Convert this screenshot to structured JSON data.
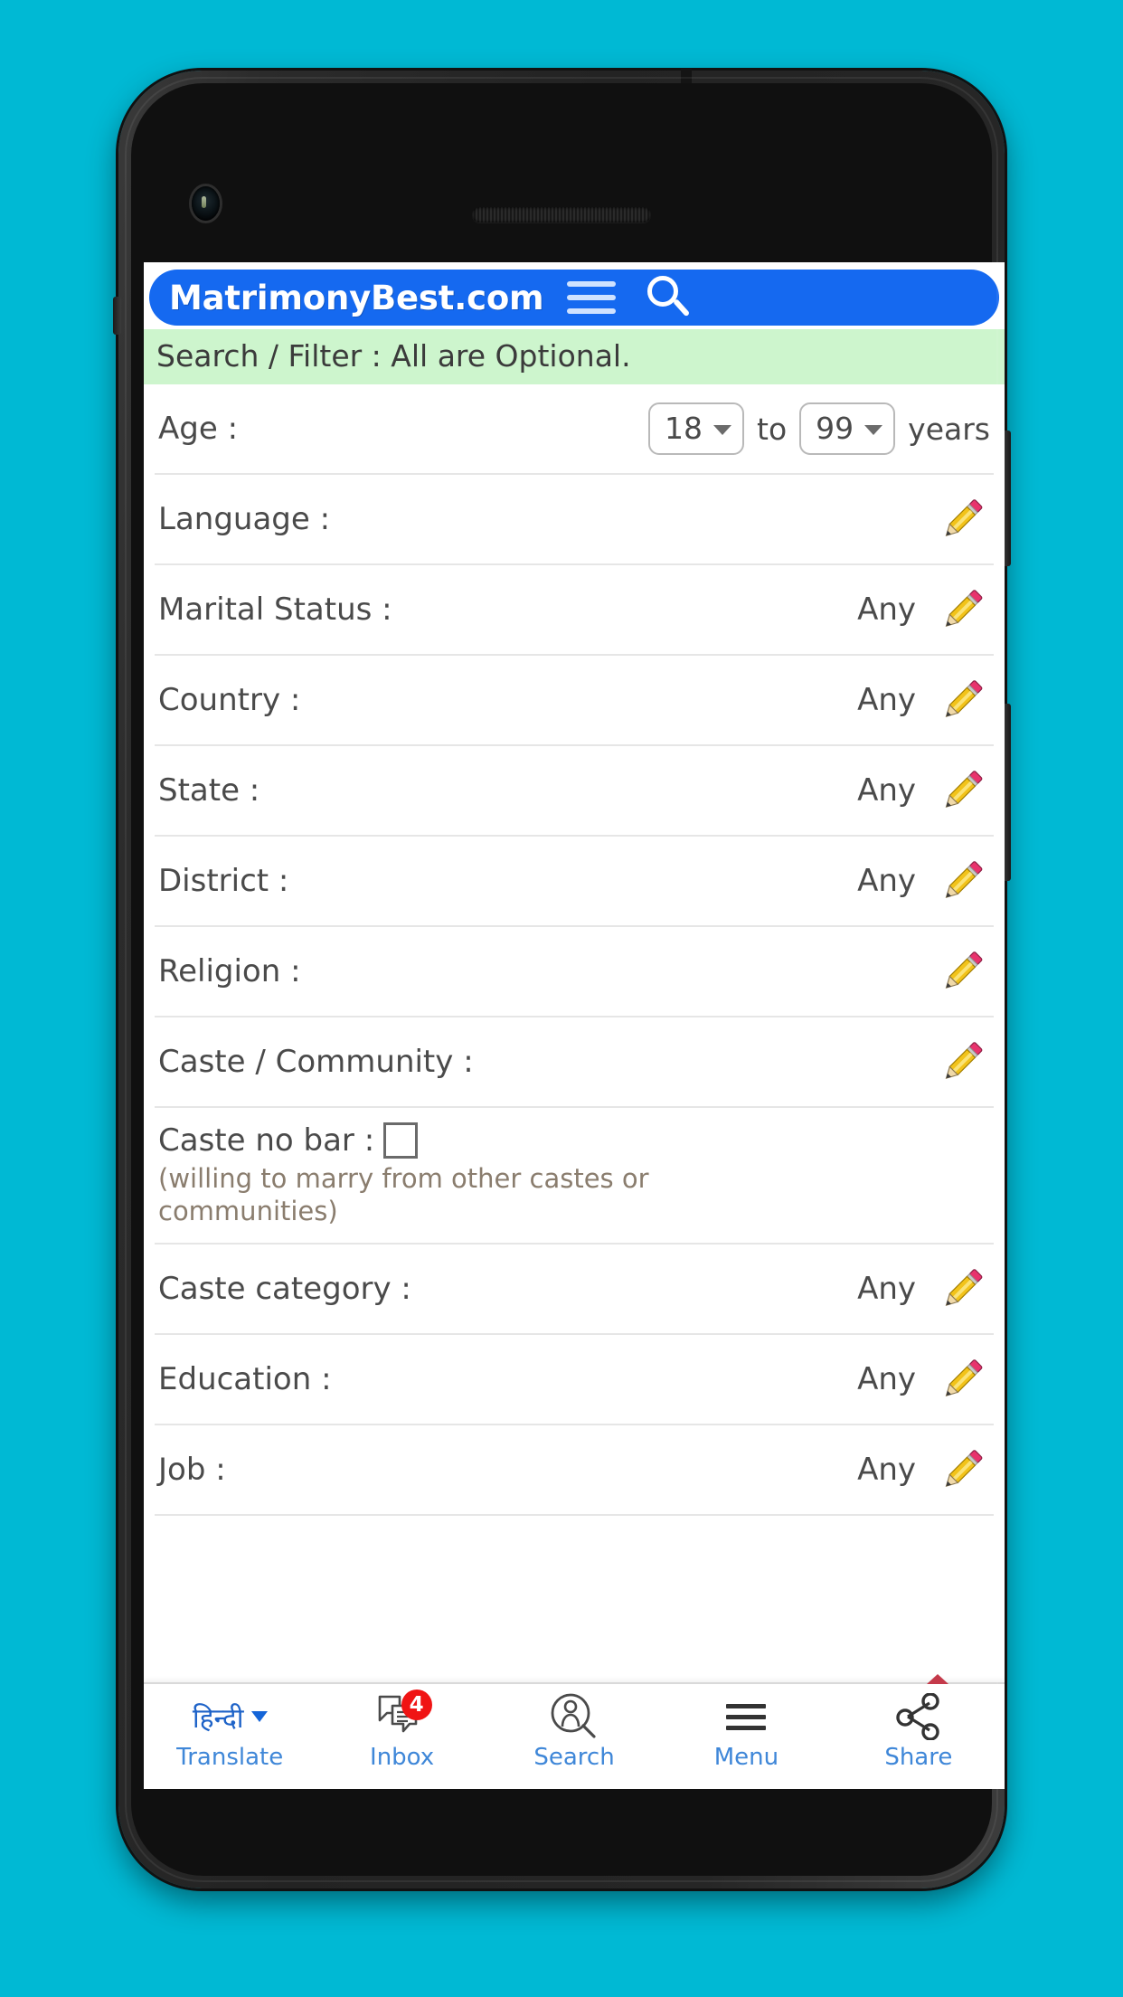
{
  "app": {
    "brand": "MatrimonyBest.com",
    "banner": "Search / Filter : All are Optional.",
    "accent_blue": "#1569f0",
    "banner_green": "#cdf5cd",
    "background_cyan": "#00b9d4"
  },
  "header": {
    "menu_icon": "hamburger-icon",
    "search_icon": "search-icon"
  },
  "age": {
    "label": "Age :",
    "from": "18",
    "to_word": "to",
    "to": "99",
    "unit": "years"
  },
  "rows": [
    {
      "label": "Language :",
      "value": "",
      "edit": true
    },
    {
      "label": "Marital Status :",
      "value": "Any",
      "edit": true
    },
    {
      "label": "Country :",
      "value": "Any",
      "edit": true
    },
    {
      "label": "State :",
      "value": "Any",
      "edit": true
    },
    {
      "label": "District :",
      "value": "Any",
      "edit": true
    },
    {
      "label": "Religion :",
      "value": "",
      "edit": true
    },
    {
      "label": "Caste / Community :",
      "value": "",
      "edit": true
    }
  ],
  "caste_no_bar": {
    "label": "Caste no bar :",
    "checked": false,
    "note": "(willing to marry from other castes or communities)"
  },
  "rows2": [
    {
      "label": "Caste category :",
      "value": "Any",
      "edit": true
    },
    {
      "label": "Education :",
      "value": "Any",
      "edit": true
    },
    {
      "label": "Job :",
      "value": "Any",
      "edit": true
    }
  ],
  "bottom_nav": [
    {
      "label": "Translate",
      "lang": "हिन्दी",
      "icon": "translate-chevron-icon",
      "badge": ""
    },
    {
      "label": "Inbox",
      "icon": "inbox-messages-icon",
      "badge": "4"
    },
    {
      "label": "Search",
      "icon": "person-search-icon",
      "badge": ""
    },
    {
      "label": "Menu",
      "icon": "hamburger-icon",
      "badge": ""
    },
    {
      "label": "Share",
      "icon": "share-nodes-icon",
      "badge": ""
    }
  ]
}
